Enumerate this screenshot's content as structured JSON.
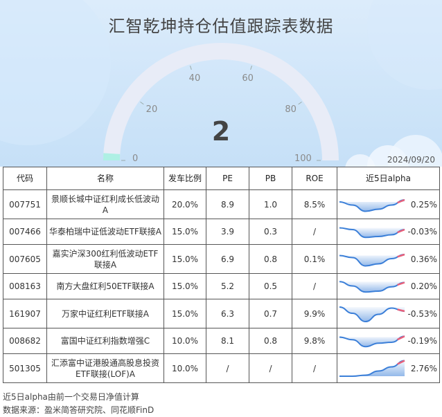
{
  "header": {
    "title": "汇智乾坤持仓估值跟踪表数据",
    "date": "2024/09/20",
    "gauge": {
      "value": 2,
      "display": "2",
      "min": 0,
      "max": 100,
      "ticks": [
        "0",
        "20",
        "40",
        "60",
        "80",
        "100"
      ]
    }
  },
  "table": {
    "columns": [
      "代码",
      "名称",
      "发车比例",
      "PE",
      "PB",
      "ROE",
      "近5日alpha"
    ],
    "rows": [
      {
        "code": "007751",
        "name": "景顺长城中证红利成长低波动A",
        "ratio": "20.0%",
        "pe": "8.9",
        "pb": "1.0",
        "roe": "8.5%",
        "alpha": "0.25%",
        "spark": [
          0.4,
          0.55,
          0.85,
          0.75,
          0.55,
          0.3
        ]
      },
      {
        "code": "007466",
        "name": "华泰柏瑞中证低波动ETF联接A",
        "ratio": "15.0%",
        "pe": "3.9",
        "pb": "0.3",
        "roe": "/",
        "alpha": "-0.03%",
        "spark": [
          0.3,
          0.4,
          0.85,
          0.8,
          0.7,
          0.4
        ]
      },
      {
        "code": "007605",
        "name": "嘉实沪深300红利低波动ETF联接A",
        "ratio": "15.0%",
        "pe": "6.9",
        "pb": "0.8",
        "roe": "0.1%",
        "alpha": "0.36%",
        "spark": [
          0.35,
          0.45,
          0.85,
          0.75,
          0.5,
          0.3
        ]
      },
      {
        "code": "008163",
        "name": "南方大盘红利50ETF联接A",
        "ratio": "15.0%",
        "pe": "5.2",
        "pb": "0.5",
        "roe": "/",
        "alpha": "0.20%",
        "spark": [
          0.25,
          0.5,
          0.85,
          0.8,
          0.55,
          0.3
        ]
      },
      {
        "code": "161907",
        "name": "万家中证红利ETF联接A",
        "ratio": "15.0%",
        "pe": "6.3",
        "pb": "0.7",
        "roe": "9.9%",
        "alpha": "-0.53%",
        "spark": [
          0.2,
          0.5,
          0.9,
          0.55,
          0.25,
          0.4
        ]
      },
      {
        "code": "008682",
        "name": "富国中证红利指数增强C",
        "ratio": "10.0%",
        "pe": "8.1",
        "pb": "0.8",
        "roe": "9.8%",
        "alpha": "-0.19%",
        "spark": [
          0.3,
          0.45,
          0.85,
          0.65,
          0.6,
          0.25
        ]
      },
      {
        "code": "501305",
        "name": "汇添富中证港股通高股息投资ETF联接(LOF)A",
        "ratio": "10.0%",
        "pe": "/",
        "pb": "/",
        "roe": "/",
        "alpha": "2.76%",
        "spark": [
          0.9,
          0.9,
          0.85,
          0.65,
          0.45,
          0.15
        ]
      }
    ]
  },
  "footer": {
    "note": "近5日alpha由前一个交易日净值计算",
    "source": "数据来源：盈米简答研究院、同花顺FinD"
  },
  "colors": {
    "gauge_track": "#e8ecf7",
    "gauge_fill": "#aef0e4",
    "spark_blue": "#3b7fd8",
    "spark_red": "#e8607a"
  }
}
